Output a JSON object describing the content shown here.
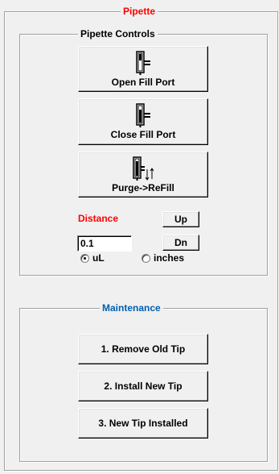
{
  "outer_group": {
    "title": "Pipette",
    "title_color": "#ff0000"
  },
  "controls_group": {
    "title": "Pipette Controls"
  },
  "buttons": {
    "open_fill_port": "Open Fill Port",
    "close_fill_port": "Close Fill Port",
    "purge_refill": "Purge->ReFill"
  },
  "distance": {
    "label": "Distance",
    "label_color": "#ff0000",
    "value": "0.1",
    "up_label": "Up",
    "dn_label": "Dn",
    "units": [
      {
        "label": "uL",
        "selected": true
      },
      {
        "label": "inches",
        "selected": false
      }
    ]
  },
  "maintenance_group": {
    "title": "Maintenance",
    "title_color": "#0060b0",
    "buttons": [
      "1. Remove Old Tip",
      "2. Install New Tip",
      "3. New Tip Installed"
    ]
  },
  "icons": [
    "fill-port-open-icon",
    "fill-port-closed-icon",
    "purge-refill-icon"
  ]
}
